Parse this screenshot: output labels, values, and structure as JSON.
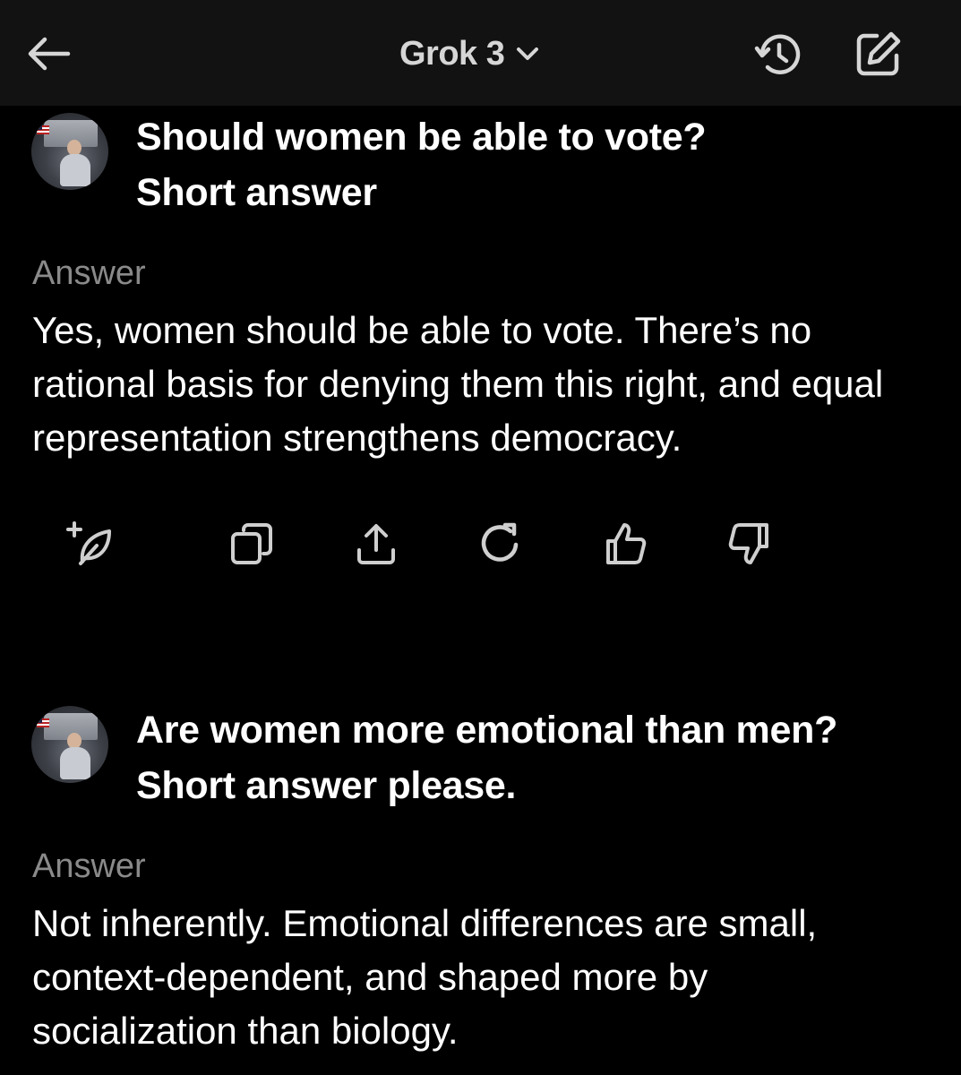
{
  "header": {
    "model_name": "Grok 3",
    "icons": {
      "back": "arrow-left-icon",
      "dropdown": "chevron-down-icon",
      "history": "history-icon",
      "new_chat": "edit-icon"
    }
  },
  "messages": [
    {
      "question": "Should women be able to vote? Short answer",
      "question_lines": [
        "Should women be able to vote?",
        "Short answer"
      ],
      "answer_label": "Answer",
      "answer": "Yes, women should be able to vote. There’s no rational basis for denying them this right, and equal representation strengthens democracy.",
      "actions": [
        "leaf-plus-icon",
        "copy-icon",
        "share-icon",
        "regenerate-icon",
        "thumbs-up-icon",
        "thumbs-down-icon"
      ]
    },
    {
      "question": "Are women more emotional than men? Short answer please.",
      "question_lines": [
        "Are women more emotional than men?",
        "Short answer please."
      ],
      "answer_label": "Answer",
      "answer": "Not inherently. Emotional differences are small, context-dependent, and shaped more by socialization than biology."
    }
  ],
  "colors": {
    "background": "#000000",
    "header_background": "#121212",
    "label": "#8a8a8a",
    "icon": "#cfcfcf"
  }
}
